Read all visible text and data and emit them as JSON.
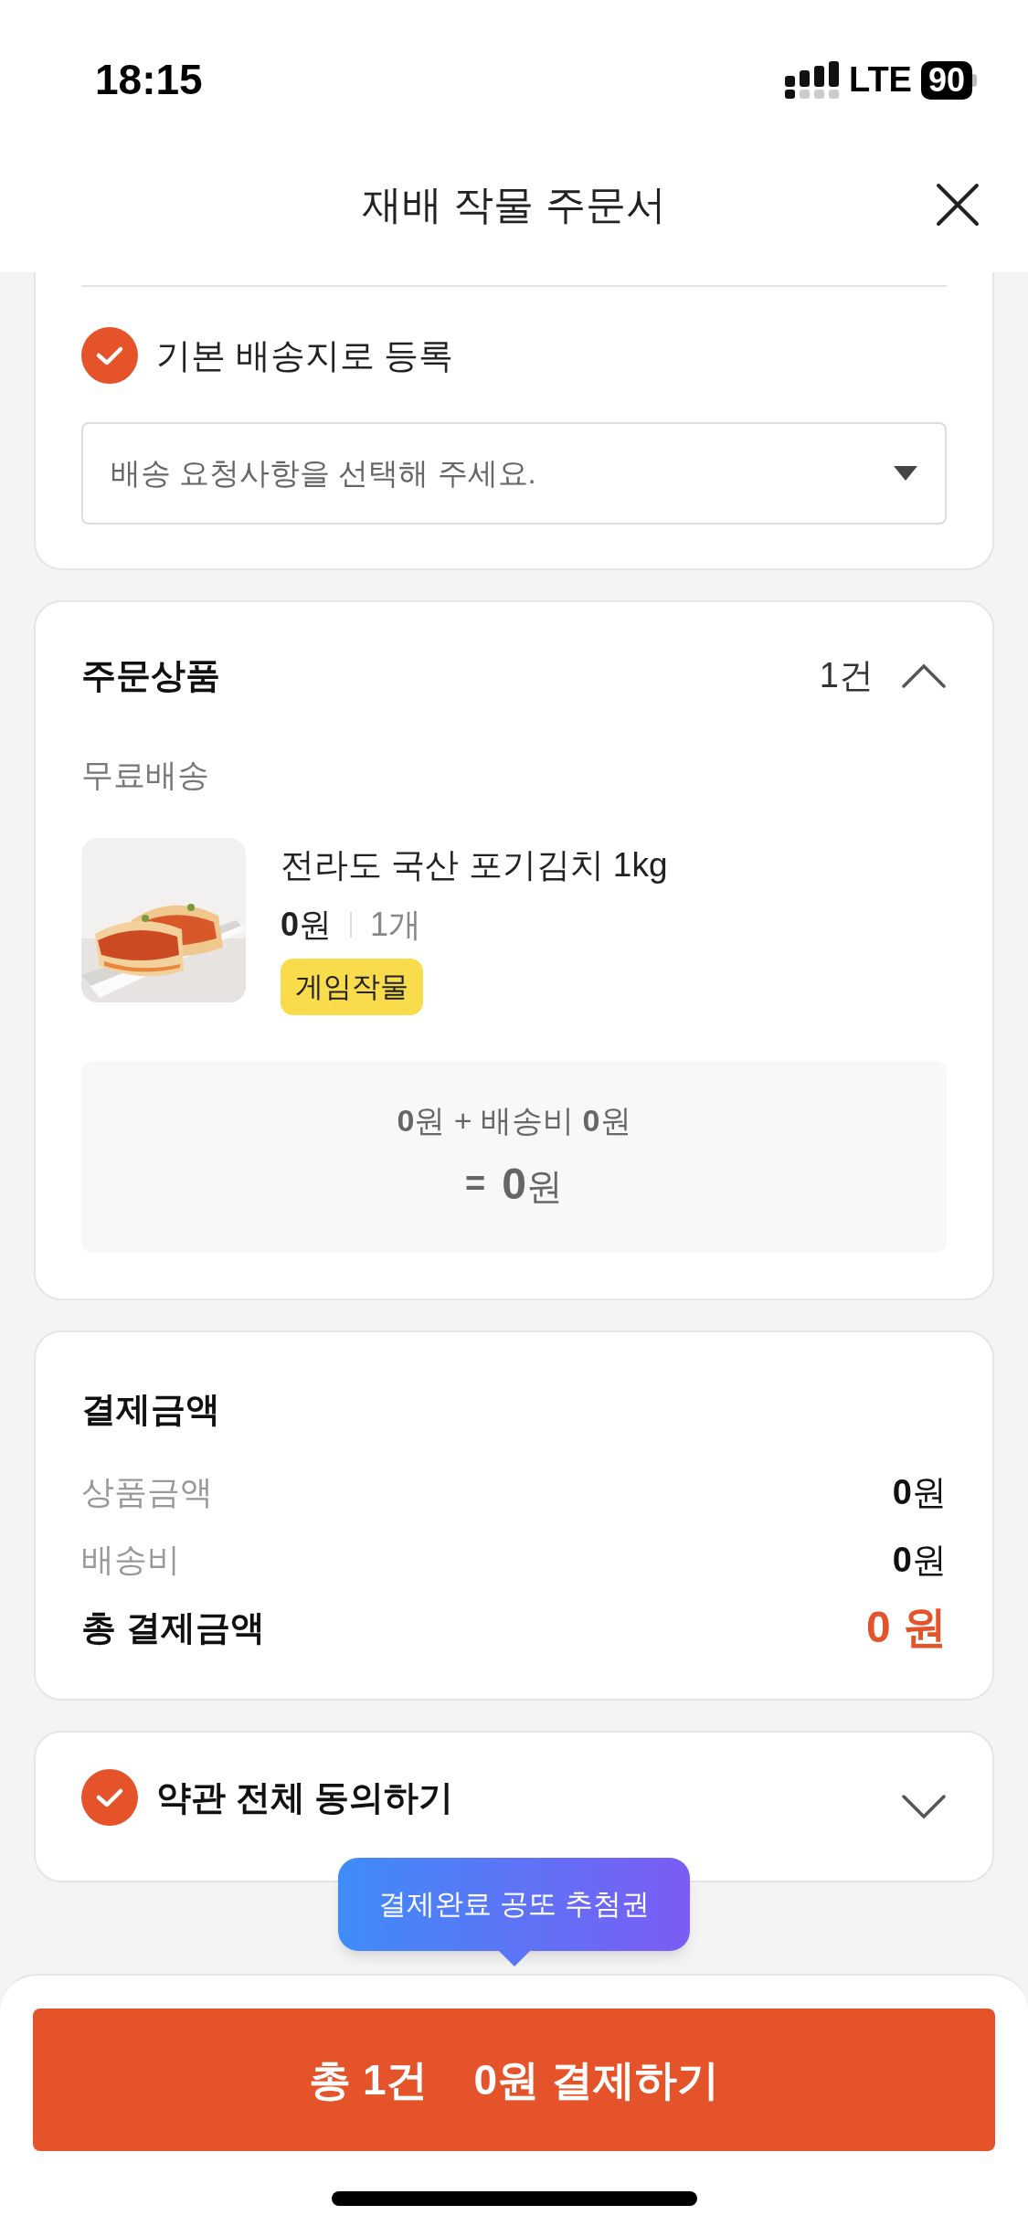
{
  "status_bar": {
    "time": "18:15",
    "network": "LTE",
    "battery": "90"
  },
  "header": {
    "title": "재배 작물 주문서"
  },
  "delivery": {
    "default_address": {
      "label": "기본 배송지로 등록",
      "checked": true
    },
    "request": {
      "placeholder": "배송 요청사항을 선택해 주세요."
    }
  },
  "order_items": {
    "title": "주문상품",
    "count": "1건",
    "expanded": true,
    "shipping": "무료배송",
    "items": [
      {
        "kind": "picture",
        "name": "전라도 국산 포기김치 1kg",
        "price_value": "0",
        "price_unit": "원",
        "quantity": "1개",
        "tag": "게임작물"
      }
    ],
    "summary": {
      "line": "**0**원 + 배송비 **0**원",
      "equals": "=",
      "total_value": "0",
      "total_unit": "원"
    }
  },
  "payment": {
    "title": "결제금액",
    "rows": [
      {
        "label": "상품금액",
        "value": "0",
        "unit": "원"
      },
      {
        "label": "배송비",
        "value": "0",
        "unit": "원"
      }
    ],
    "total": {
      "label": "총 결제금액",
      "value": "0 원"
    }
  },
  "terms": {
    "label": "약관 전체 동의하기",
    "checked": true,
    "expanded": false
  },
  "tooltip": {
    "text": "결제완료 공또 추첨권"
  },
  "pay_button": {
    "count": "총 1건",
    "amount": "0원 결제하기"
  }
}
